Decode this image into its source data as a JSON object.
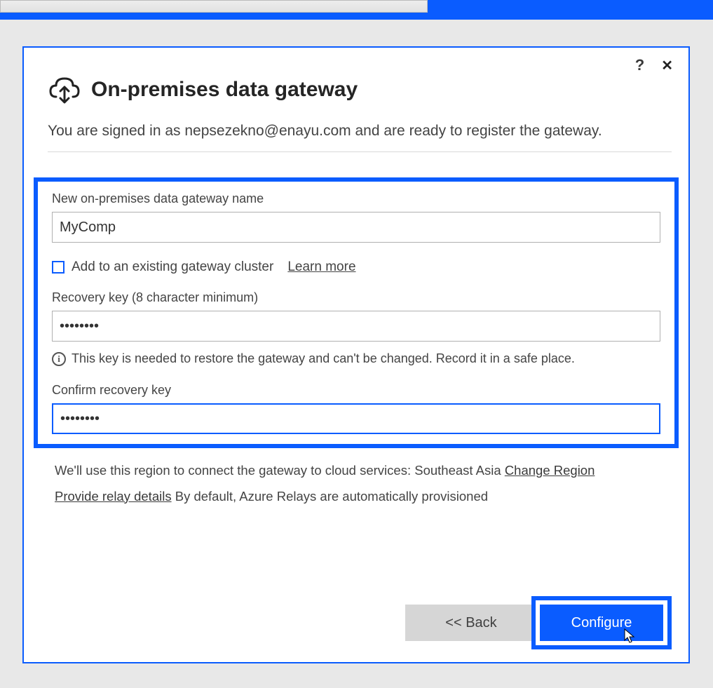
{
  "dialog": {
    "title": "On-premises data gateway",
    "signin_prefix": "You are signed in as ",
    "signin_email": "nepsezekno@enayu.com",
    "signin_suffix": " and are ready to register the gateway.",
    "help_symbol": "?",
    "close_symbol": "✕"
  },
  "form": {
    "name_label": "New on-premises data gateway name",
    "name_value": "MyComp",
    "add_cluster_label": "Add to an existing gateway cluster",
    "learn_more": "Learn more",
    "recovery_label": "Recovery key (8 character minimum)",
    "recovery_value": "••••••••",
    "info_icon": "i",
    "info_text": "This key is needed to restore the gateway and can't be changed. Record it in a safe place.",
    "confirm_label": "Confirm recovery key",
    "confirm_value": "••••••••"
  },
  "region": {
    "line1_prefix": "We'll use this region to connect the gateway to cloud services: ",
    "region_name": "Southeast Asia ",
    "change_region": "Change Region",
    "relay_link": "Provide relay details",
    "relay_suffix": " By default, Azure Relays are automatically provisioned"
  },
  "buttons": {
    "back": "<< Back",
    "configure": "Configure"
  }
}
